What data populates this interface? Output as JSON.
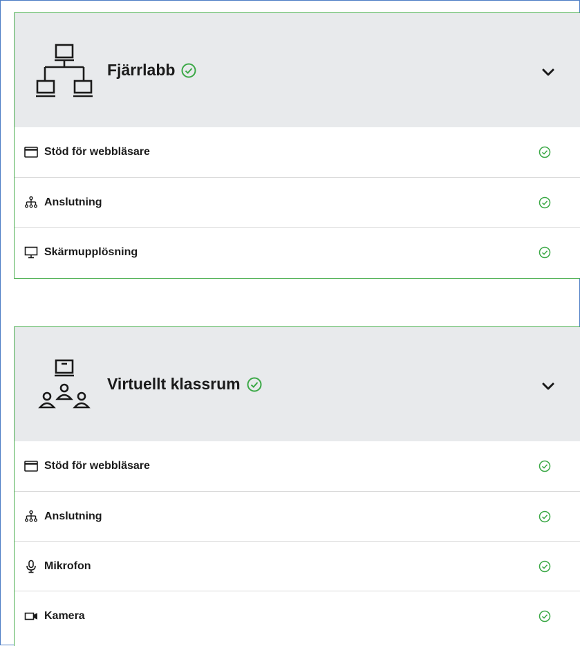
{
  "panels": [
    {
      "title": "Fjärrlabb",
      "header_icon": "remote-lab-network-icon",
      "status": "passed",
      "items": [
        {
          "label": "Stöd för webbläsare",
          "icon": "browser-window-icon",
          "status": "passed"
        },
        {
          "label": "Anslutning",
          "icon": "network-tree-icon",
          "status": "passed"
        },
        {
          "label": "Skärmupplösning",
          "icon": "monitor-icon",
          "status": "passed"
        }
      ]
    },
    {
      "title": "Virtuellt klassrum",
      "header_icon": "virtual-classroom-icon",
      "status": "passed",
      "items": [
        {
          "label": "Stöd för webbläsare",
          "icon": "browser-window-icon",
          "status": "passed"
        },
        {
          "label": "Anslutning",
          "icon": "network-tree-icon",
          "status": "passed"
        },
        {
          "label": "Mikrofon",
          "icon": "microphone-icon",
          "status": "passed"
        },
        {
          "label": "Kamera",
          "icon": "camera-icon",
          "status": "passed"
        }
      ]
    }
  ],
  "colors": {
    "success": "#3aa845",
    "panel_border": "#4caf50",
    "header_bg": "#e8eaec",
    "text": "#1a1a1a",
    "divider": "#d9d9d9",
    "frame_border": "#4a7bc4"
  }
}
